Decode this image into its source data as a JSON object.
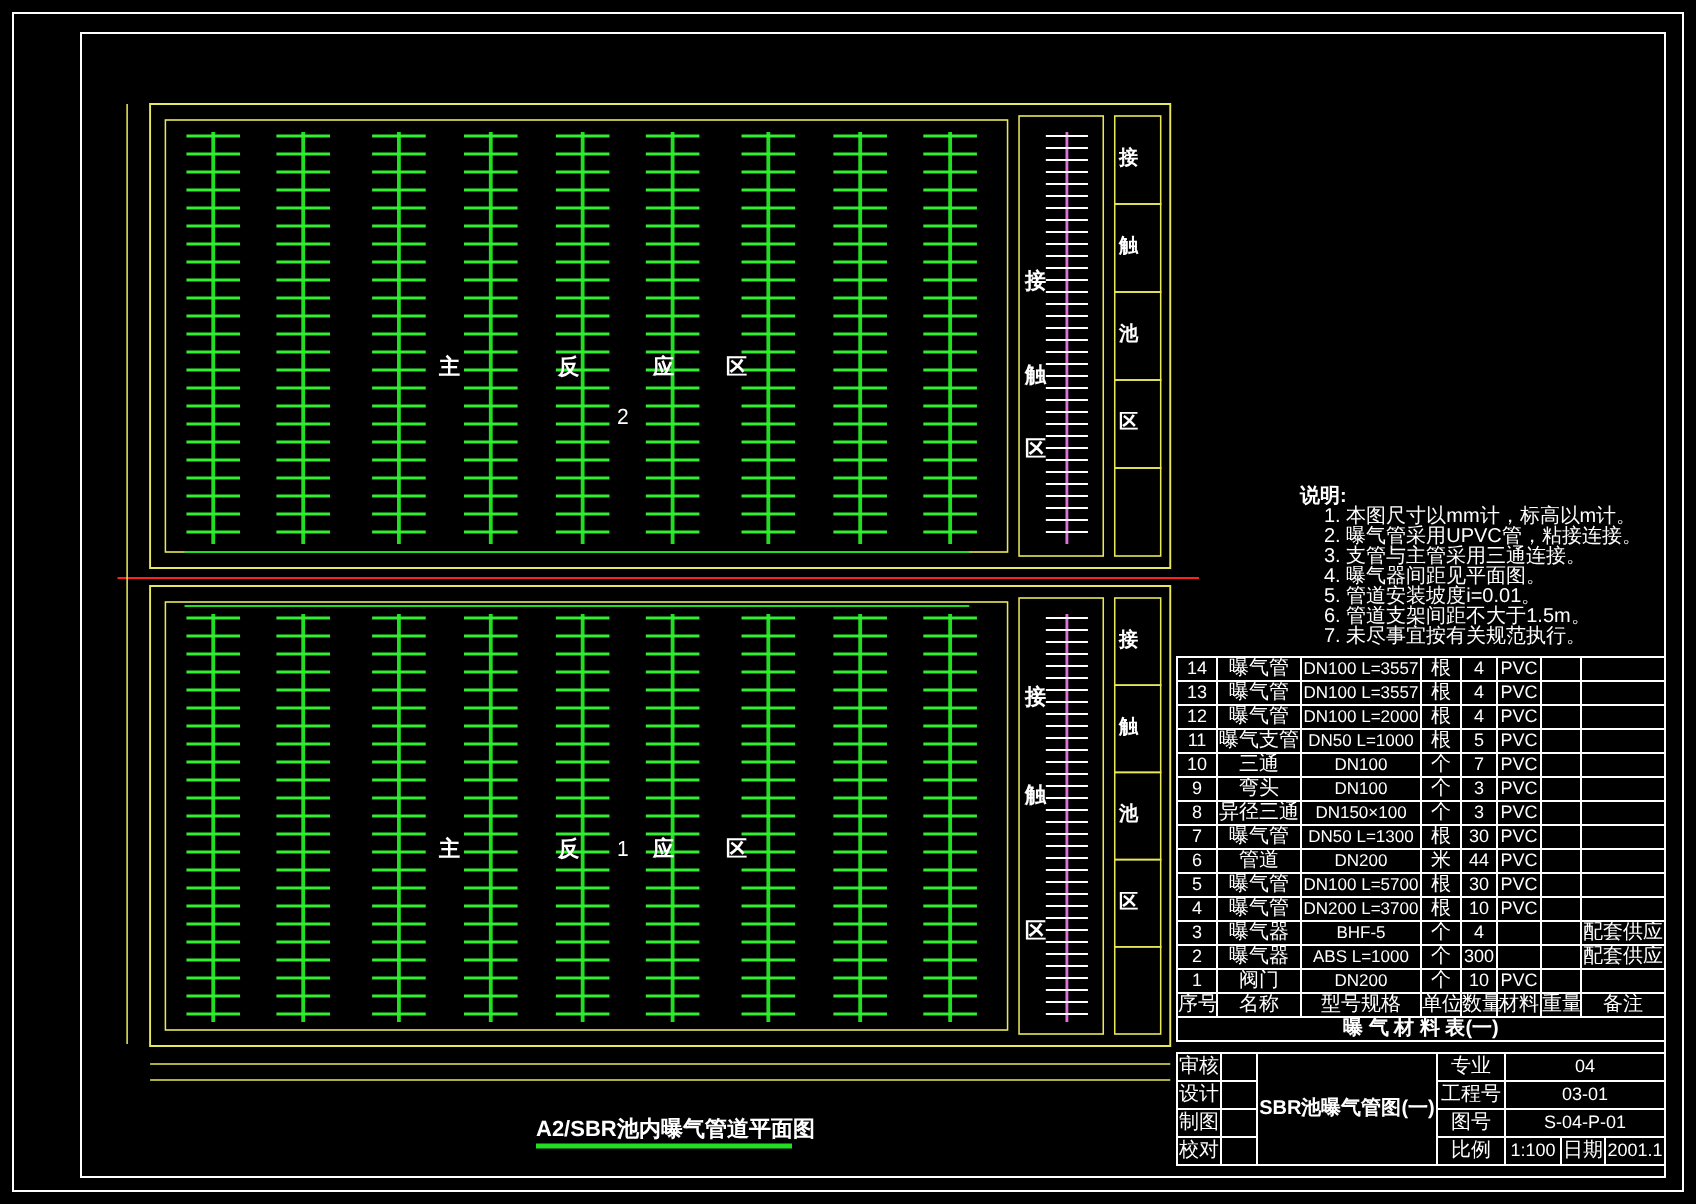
{
  "drawing_title": "A2/SBR池内曝气管道平面图",
  "plan": {
    "tanks": [
      {
        "number": "2",
        "zone_chars": [
          "主",
          "反",
          "应",
          "区"
        ],
        "contact_chars": [
          "接",
          "触",
          "区"
        ],
        "cell_chars": [
          "接",
          "触",
          "池",
          "区"
        ]
      },
      {
        "number": "1",
        "zone_chars": [
          "主",
          "反",
          "应",
          "区"
        ],
        "contact_chars": [
          "接",
          "触",
          "区"
        ],
        "cell_chars": [
          "接",
          "触",
          "池",
          "区"
        ]
      }
    ]
  },
  "notes": {
    "heading": "说明:",
    "items": [
      "1. 本图尺寸以mm计，标高以m计。",
      "2. 曝气管采用UPVC管，粘接连接。",
      "3. 支管与主管采用三通连接。",
      "4. 曝气器间距见平面图。",
      "5. 管道安装坡度i=0.01。",
      "6. 管道支架间距不大于1.5m。",
      "7. 未尽事宜按有关规范执行。"
    ]
  },
  "material_table": {
    "title": "曝 气 材 料 表(一)",
    "columns": [
      "序号",
      "名称",
      "型号规格",
      "单位",
      "数量",
      "材料",
      "重量",
      "备注"
    ],
    "rows": [
      {
        "no": "14",
        "name": "曝气管",
        "spec": "DN100 L=3557",
        "unit": "根",
        "qty": "4",
        "material": "PVC"
      },
      {
        "no": "13",
        "name": "曝气管",
        "spec": "DN100 L=3557",
        "unit": "根",
        "qty": "4",
        "material": "PVC"
      },
      {
        "no": "12",
        "name": "曝气管",
        "spec": "DN100 L=2000",
        "unit": "根",
        "qty": "4",
        "material": "PVC"
      },
      {
        "no": "11",
        "name": "曝气支管",
        "spec": "DN50 L=1000",
        "unit": "根",
        "qty": "5",
        "material": "PVC"
      },
      {
        "no": "10",
        "name": "三通",
        "spec": "DN100",
        "unit": "个",
        "qty": "7",
        "material": "PVC"
      },
      {
        "no": "9",
        "name": "弯头",
        "spec": "DN100",
        "unit": "个",
        "qty": "3",
        "material": "PVC"
      },
      {
        "no": "8",
        "name": "异径三通",
        "spec": "DN150×100",
        "unit": "个",
        "qty": "3",
        "material": "PVC"
      },
      {
        "no": "7",
        "name": "曝气管",
        "spec": "DN50 L=1300",
        "unit": "根",
        "qty": "30",
        "material": "PVC"
      },
      {
        "no": "6",
        "name": "管道",
        "spec": "DN200",
        "unit": "米",
        "qty": "44",
        "material": "PVC"
      },
      {
        "no": "5",
        "name": "曝气管",
        "spec": "DN100 L=5700",
        "unit": "根",
        "qty": "30",
        "material": "PVC"
      },
      {
        "no": "4",
        "name": "曝气管",
        "spec": "DN200 L=3700",
        "unit": "根",
        "qty": "10",
        "material": "PVC"
      },
      {
        "no": "3",
        "name": "曝气器",
        "spec": "BHF-5",
        "unit": "个",
        "qty": "4",
        "remark": "配套供应"
      },
      {
        "no": "2",
        "name": "曝气器",
        "spec": "ABS L=1000",
        "unit": "个",
        "qty": "300",
        "remark": "配套供应"
      },
      {
        "no": "1",
        "name": "阀门",
        "spec": "DN200",
        "unit": "个",
        "qty": "10",
        "material": "PVC"
      }
    ]
  },
  "title_block": {
    "drawing_name": "SBR池曝气管图(一)",
    "left_labels": [
      "审核",
      "设计",
      "制图",
      "校对"
    ],
    "fields": [
      {
        "label": "专业",
        "value": "04"
      },
      {
        "label": "工程号",
        "value": "03-01"
      },
      {
        "label": "图号",
        "value": "S-04-P-01"
      },
      {
        "label": "比例",
        "value": "1:100"
      },
      {
        "label": "日期",
        "value": "2001.1"
      }
    ]
  }
}
